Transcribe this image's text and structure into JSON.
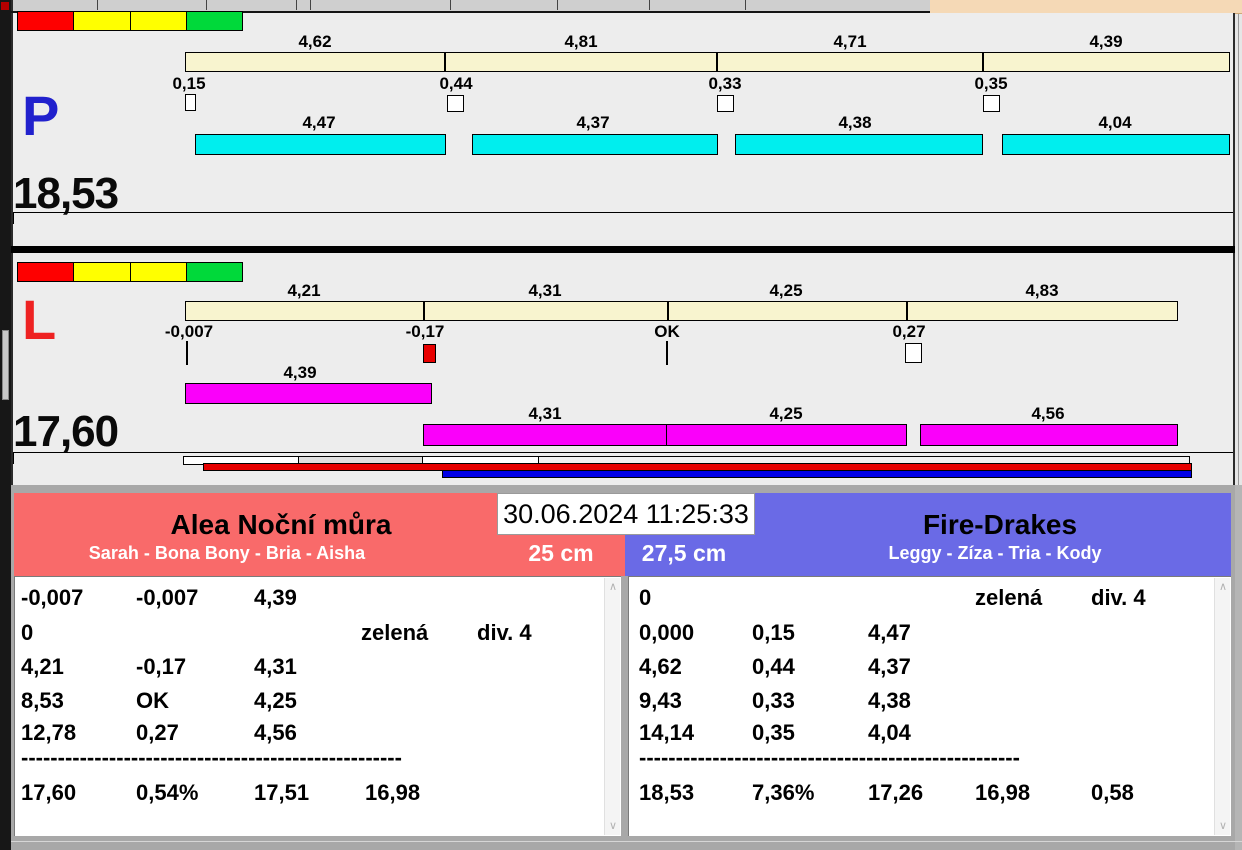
{
  "colors": {
    "scale_red": "#fe0000",
    "scale_yellow": "#ffff00",
    "scale_green": "#00d93a",
    "split_bar_cream": "#f8f4cf",
    "leg_bar_cyan": "#00eeee",
    "leg_bar_magenta": "#fa00fa",
    "team_left_red": "#f96a6a",
    "team_right_blue": "#6a6ae6",
    "progress_red": "#e60000",
    "progress_blue": "#0000e6",
    "p_letter_blue": "#2121cd",
    "l_letter_red": "#ee2222"
  },
  "icons": {
    "scroll_up": "∧",
    "scroll_down": "∨"
  },
  "p_panel": {
    "label": "P",
    "total": "18,53",
    "splits": [
      "4,62",
      "4,81",
      "4,71",
      "4,39"
    ],
    "changes": [
      "0,15",
      "0,44",
      "0,33",
      "0,35"
    ],
    "change_marks": [
      "white-box",
      "white-box",
      "white-box",
      "white-box"
    ],
    "legs": [
      "4,47",
      "4,37",
      "4,38",
      "4,04"
    ]
  },
  "l_panel": {
    "label": "L",
    "total": "17,60",
    "splits": [
      "4,21",
      "4,31",
      "4,25",
      "4,83"
    ],
    "changes": [
      "-0,007",
      "-0,17",
      "OK",
      "0,27"
    ],
    "change_marks": [
      "tick",
      "red-box",
      "tick",
      "white-box"
    ],
    "first_leg": "4,39",
    "legs": [
      "4,31",
      "4,25",
      "4,56"
    ]
  },
  "scoreboard": {
    "datetime": "30.06.2024 11:25:33",
    "left_team": {
      "name": "Alea Noční můra",
      "dogs": "Sarah - Bona Bony - Bria - Aisha",
      "height": "25 cm"
    },
    "right_team": {
      "name": "Fire-Drakes",
      "dogs": "Leggy - Zíza - Tria - Kody",
      "height": "27,5 cm"
    }
  },
  "left_results": {
    "rows": [
      [
        "-0,007",
        "-0,007",
        "4,39",
        "",
        ""
      ],
      [
        "0",
        "",
        "",
        "zelená",
        "div. 4"
      ],
      [
        "4,21",
        "-0,17",
        "4,31",
        "",
        ""
      ],
      [
        "8,53",
        "OK",
        "4,25",
        "",
        ""
      ],
      [
        "12,78",
        "0,27",
        "4,56",
        "",
        ""
      ]
    ],
    "separator": "----------------------------------------------------",
    "total": [
      "17,60",
      "0,54%",
      "17,51",
      "16,98",
      ""
    ]
  },
  "right_results": {
    "rows": [
      [
        "0",
        "",
        "",
        "zelená",
        "div. 4"
      ],
      [
        "0,000",
        "0,15",
        "4,47",
        "",
        ""
      ],
      [
        "4,62",
        "0,44",
        "4,37",
        "",
        ""
      ],
      [
        "9,43",
        "0,33",
        "4,38",
        "",
        ""
      ],
      [
        "14,14",
        "0,35",
        "4,04",
        "",
        ""
      ]
    ],
    "separator": "----------------------------------------------------",
    "total": [
      "18,53",
      "7,36%",
      "17,26",
      "16,98",
      "0,58"
    ]
  }
}
